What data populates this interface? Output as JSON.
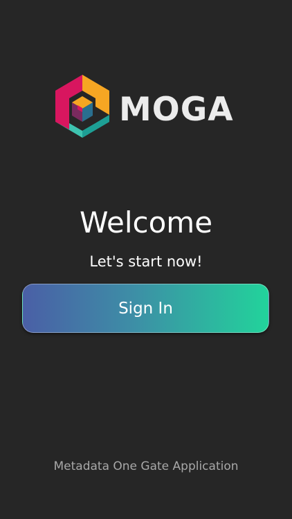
{
  "logo": {
    "wordmark": "MOGA",
    "icon": "hexagon-cube-logo-icon",
    "colors": {
      "magenta": "#d8165f",
      "orange": "#f6a623",
      "teal": "#3ec3b0",
      "dark_teal": "#1d7f7a",
      "purple": "#7a2a5e"
    }
  },
  "welcome": {
    "title": "Welcome",
    "subtitle": "Let's start now!"
  },
  "actions": {
    "sign_in_label": "Sign In",
    "gradient_start": "#4a5fa6",
    "gradient_end": "#22d39b"
  },
  "footer": {
    "text": "Metadata One Gate Application"
  },
  "theme": {
    "background": "#262626"
  }
}
